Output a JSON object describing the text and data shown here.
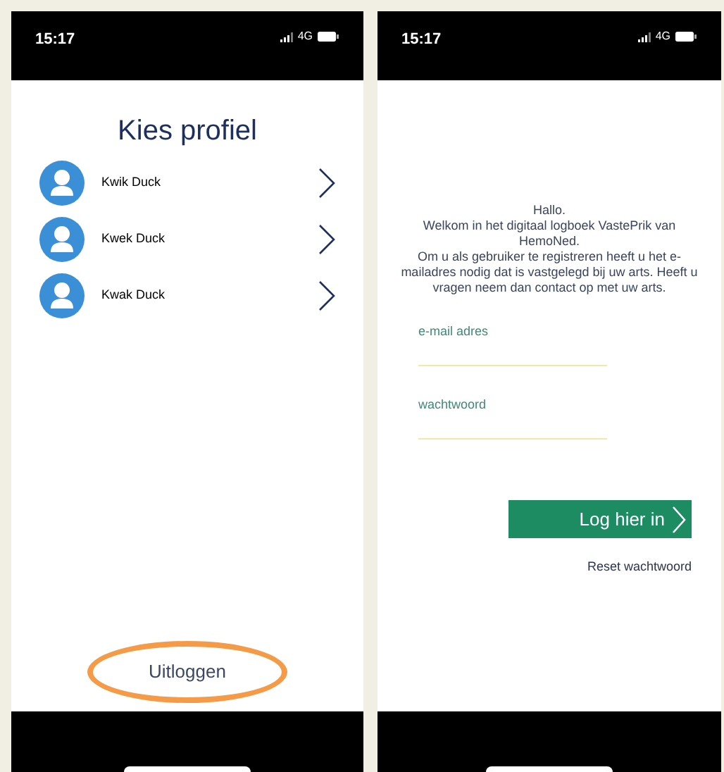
{
  "profile_screen": {
    "status_bar": {
      "time": "15:17",
      "network": "4G"
    },
    "title": "Kies profiel",
    "profiles": [
      {
        "name": "Kwik Duck"
      },
      {
        "name": "Kwek Duck"
      },
      {
        "name": "Kwak Duck"
      }
    ],
    "logout": {
      "label": "Uitloggen",
      "highlighted": true
    }
  },
  "login_screen": {
    "status_bar": {
      "time": "15:17",
      "network": "4G"
    },
    "welcome_lines": [
      "Hallo.",
      "Welkom in het digitaal logboek VastePrik van HemoNed.",
      "Om u als gebruiker te registreren heeft u het e-mailadres nodig dat is vastgelegd bij uw arts. Heeft u vragen neem dan contact op met uw arts."
    ],
    "fields": [
      {
        "placeholder": "e-mail adres"
      },
      {
        "placeholder": "wachtwoord"
      }
    ],
    "login_button": "Log hier in",
    "reset_link": "Reset wachtwoord"
  }
}
